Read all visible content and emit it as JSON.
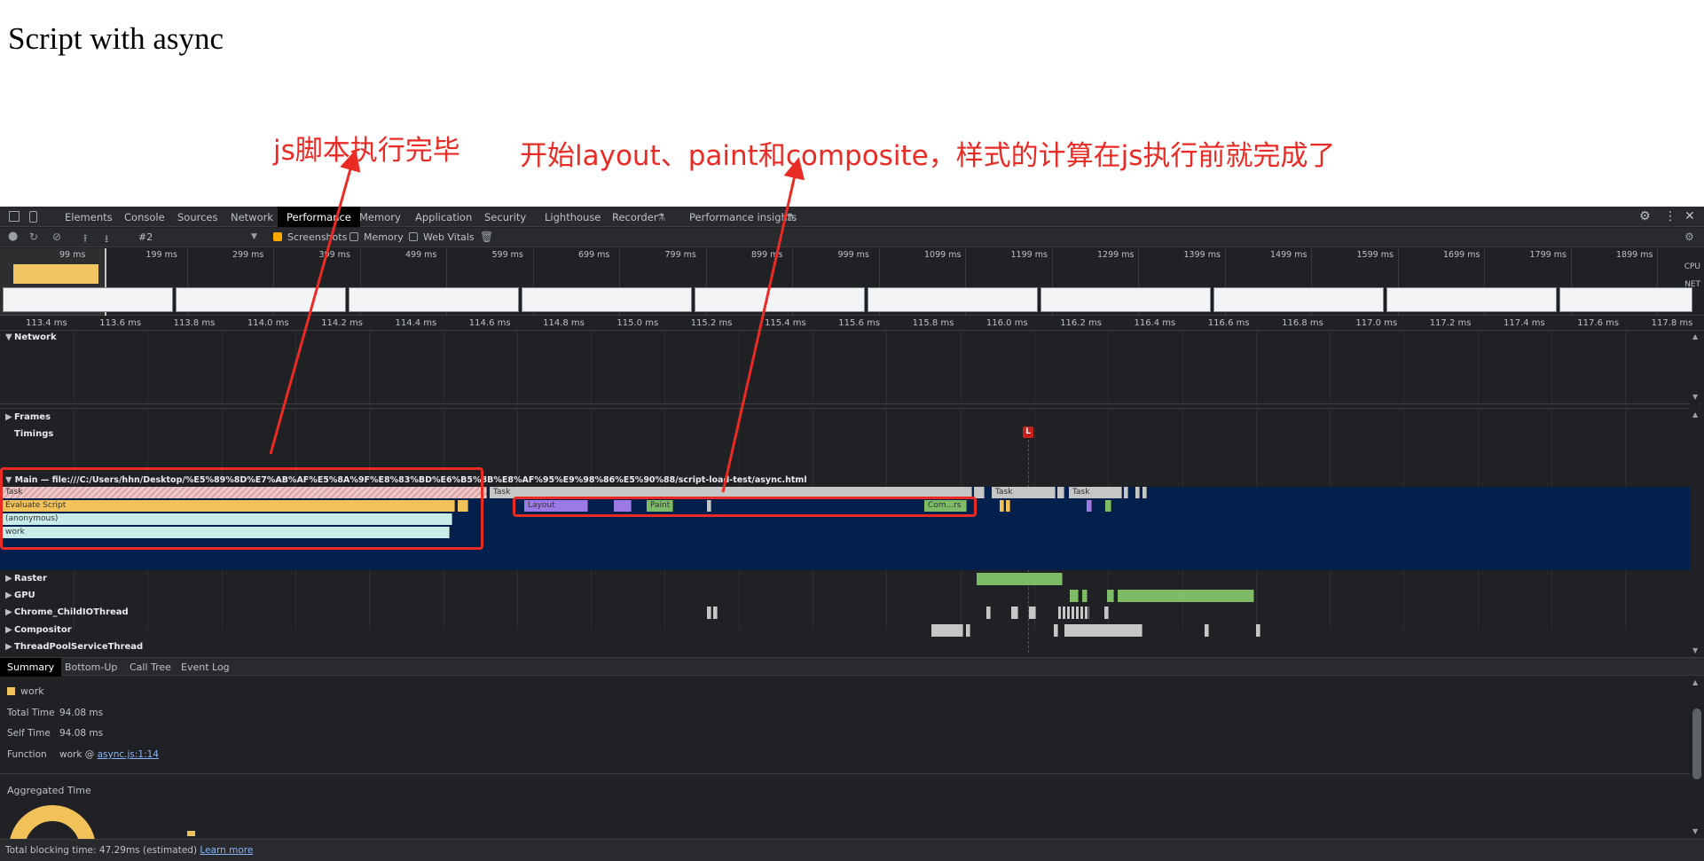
{
  "page": {
    "title": "Script with async"
  },
  "annotations": {
    "left": "js脚本执行完毕",
    "right": "开始layout、paint和composite，样式的计算在js执行前就完成了"
  },
  "devtools": {
    "tabs": [
      "Elements",
      "Console",
      "Sources",
      "Network",
      "Performance",
      "Memory",
      "Application",
      "Security",
      "Lighthouse",
      "Recorder",
      "Performance insights"
    ],
    "active_tab": "Performance",
    "toolbar": {
      "profile": "#2",
      "screenshots_label": "Screenshots",
      "screenshots_checked": true,
      "memory_label": "Memory",
      "memory_checked": false,
      "webvitals_label": "Web Vitals",
      "webvitals_checked": false
    },
    "overview": {
      "ticks": [
        "99 ms",
        "199 ms",
        "299 ms",
        "399 ms",
        "499 ms",
        "599 ms",
        "699 ms",
        "799 ms",
        "899 ms",
        "999 ms",
        "1099 ms",
        "1199 ms",
        "1299 ms",
        "1399 ms",
        "1499 ms",
        "1599 ms",
        "1699 ms",
        "1799 ms",
        "1899 ms"
      ],
      "cpu_label": "CPU",
      "net_label": "NET"
    },
    "ruler": [
      "113.4 ms",
      "113.6 ms",
      "113.8 ms",
      "114.0 ms",
      "114.2 ms",
      "114.4 ms",
      "114.6 ms",
      "114.8 ms",
      "115.0 ms",
      "115.2 ms",
      "115.4 ms",
      "115.6 ms",
      "115.8 ms",
      "116.0 ms",
      "116.2 ms",
      "116.4 ms",
      "116.6 ms",
      "116.8 ms",
      "117.0 ms",
      "117.2 ms",
      "117.4 ms",
      "117.6 ms",
      "117.8 ms"
    ],
    "tracks": {
      "network": "Network",
      "frames": "Frames",
      "timings": "Timings",
      "timing_marker": "L",
      "main": "Main — file:///C:/Users/hhn/Desktop/%E5%89%8D%E7%AB%AF%E5%8A%9F%E8%83%BD%E6%B5%8B%E8%AF%95%E9%98%86%E5%90%88/script-load-test/async.html",
      "raster": "Raster",
      "gpu": "GPU",
      "io": "Chrome_ChildIOThread",
      "compositor": "Compositor",
      "threadpool": "ThreadPoolServiceThread"
    },
    "flame": {
      "task": "Task",
      "evaluate": "Evaluate Script",
      "anonymous": "(anonymous)",
      "work": "work",
      "layout": "Layout",
      "paint": "Paint",
      "composite": "Com...rs"
    },
    "bottom_tabs": [
      "Summary",
      "Bottom-Up",
      "Call Tree",
      "Event Log"
    ],
    "summary": {
      "name": "work",
      "total_time_label": "Total Time",
      "total_time": "94.08 ms",
      "self_time_label": "Self Time",
      "self_time": "94.08 ms",
      "function_label": "Function",
      "function_name": "work @",
      "function_link": "async.js:1:14",
      "aggregated_title": "Aggregated Time"
    },
    "status": {
      "text": "Total blocking time: 47.29ms (estimated)",
      "link": "Learn more"
    }
  },
  "colors": {
    "annotation": "#ea2a24",
    "main_bg": "#03204d",
    "scripting": "#f2c25a",
    "rendering": "#9b7ae6",
    "painting": "#7dbb67"
  }
}
